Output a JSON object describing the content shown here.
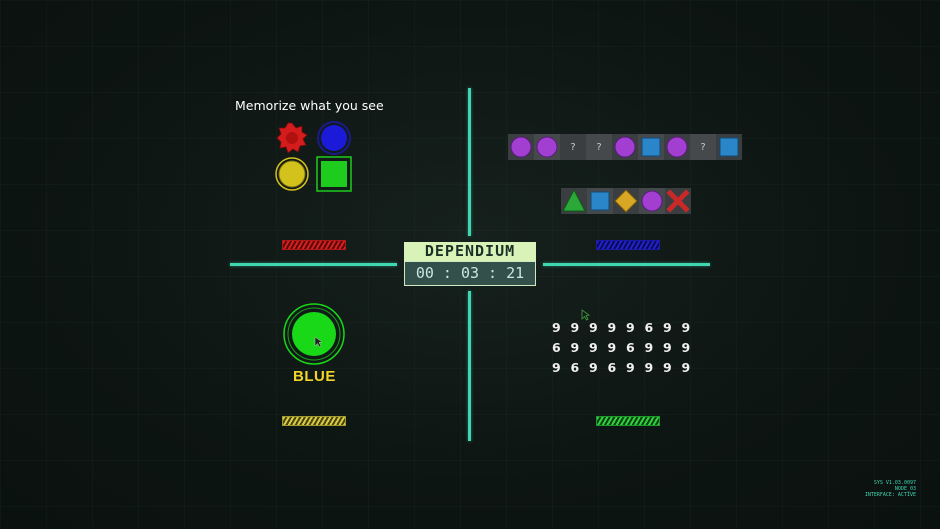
{
  "title": "DEPENDIUM",
  "timer": "00 : 03 : 21",
  "memory": {
    "instruction": "Memorize what you see",
    "shapes": [
      {
        "shape": "star-gear",
        "color": "#d41c1c"
      },
      {
        "shape": "circle",
        "color": "#1a1ad8"
      },
      {
        "shape": "circle",
        "color": "#d4c21c"
      },
      {
        "shape": "square",
        "color": "#1ecc1e"
      }
    ],
    "progress_color": "#d42020"
  },
  "sequence": {
    "row1": [
      {
        "shape": "circle",
        "color": "#a23ed0"
      },
      {
        "shape": "circle",
        "color": "#a23ed0"
      },
      {
        "shape": "unknown",
        "label": "?"
      },
      {
        "shape": "unknown",
        "label": "?"
      },
      {
        "shape": "circle",
        "color": "#a23ed0"
      },
      {
        "shape": "square",
        "color": "#2a86c8"
      },
      {
        "shape": "circle",
        "color": "#a23ed0"
      },
      {
        "shape": "unknown",
        "label": "?"
      },
      {
        "shape": "square",
        "color": "#2a86c8"
      }
    ],
    "row2": [
      {
        "shape": "triangle",
        "color": "#2aa838"
      },
      {
        "shape": "square",
        "color": "#2a86c8"
      },
      {
        "shape": "diamond",
        "color": "#d8a824"
      },
      {
        "shape": "circle",
        "color": "#a23ed0"
      },
      {
        "shape": "cross",
        "color": "#c82828"
      }
    ],
    "progress_color": "#2222cc"
  },
  "color_match": {
    "circle_color": "#18d818",
    "word": "BLUE",
    "word_color": "#f2d52a",
    "progress_color": "#d8cc44"
  },
  "digits": {
    "rows": [
      [
        "9",
        "9",
        "9",
        "9",
        "9",
        "6",
        "9",
        "9"
      ],
      [
        "6",
        "9",
        "9",
        "9",
        "6",
        "9",
        "9",
        "9"
      ],
      [
        "9",
        "6",
        "9",
        "6",
        "9",
        "9",
        "9",
        "9"
      ]
    ],
    "progress_color": "#30d040"
  },
  "sys_info": [
    "SYS V1.03.0097",
    "NODE_03",
    "INTERFACE: ACTIVE"
  ]
}
